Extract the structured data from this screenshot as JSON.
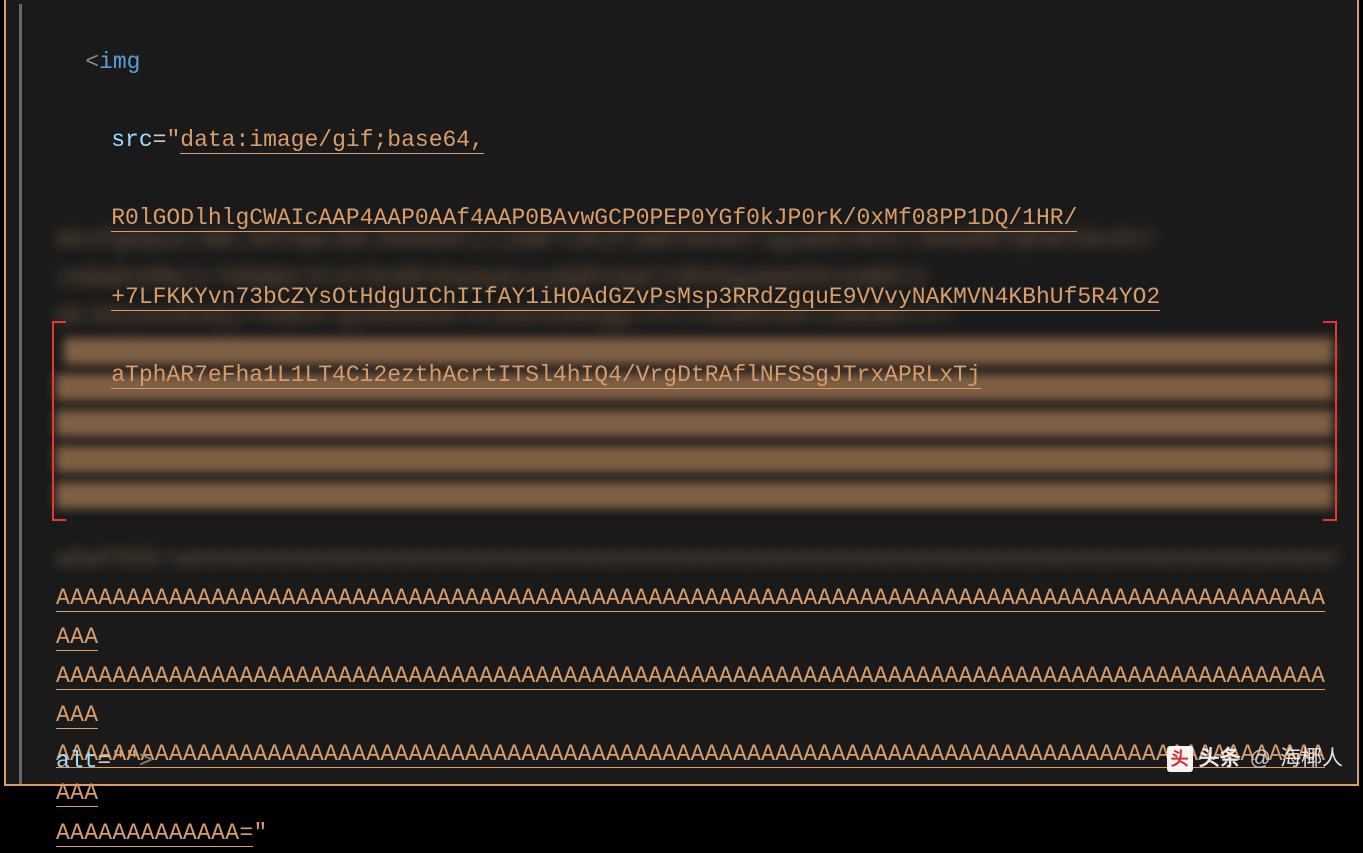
{
  "code": {
    "tag_open_bracket": "<",
    "tag_name": "img",
    "attr_src": "src",
    "eq": "=",
    "quote": "\"",
    "src_value_line1": "data:image/gif;base64,",
    "src_value_line2": "R0lGODlhlgCWAIcAAP4AAP0AAf4AAP0BAvwGCP0PEP0YGf0kJP0rK/0xMf08PP1DQ/1HR/",
    "src_value_line3": "+7LFKKYvn73bCZYsOtHdgUIChIIfAY1iHOAdGZvPsMsp3RRdZgquE9VVvyNAKMVN4KBhUf5R4YO2",
    "src_value_line4": "aTphAR7eFha1L1LT4Ci2ezthAcrtITSl4hIQ4/VrgDtRAflNFSSgJTrxAPRLxTj",
    "a_run1": "AAAAAAAAAAAAAAAAAAAAAAAAAAAAAAAAAAAAAAAAAAAAAAAAAAAAAAAAAAAAAAAAAAAAAAAAAAAAAAAAAAAAAAAAAAAAA",
    "a_run2": "AAAAAAAAAAAAAAAAAAAAAAAAAAAAAAAAAAAAAAAAAAAAAAAAAAAAAAAAAAAAAAAAAAAAAAAAAAAAAAAAAAAAAAAAAAAAA",
    "a_run3": "AAAAAAAAAAAAAAAAAAAAAAAAAAAAAAAAAAAAAAAAAAAAAAAAAAAAAAAAAAAAAAAAAAAAAAAAAAAAAAAAAAAAAAAAAAAAA",
    "a_run4": "AAAAAAAAAAAAA=",
    "attr_alt": "alt",
    "alt_value": "",
    "tag_close_bracket": ">"
  },
  "watermark": {
    "brand": "头条",
    "at": "@",
    "user": "海椰人"
  },
  "blurred": {
    "filler1": "mKxPgKQuarABcJKPnQwlBkJDkRdAFyljUWFTyRjPjWECNkHdYlgywDEcRCk7JRAdMRYQPwFkDcEk7",
    "filler2": "JaBqRnHMwlc7HGWQelFckYDvBFUDwAwAxayQQPhdgFtURkRgwAmGOHvomB9l2",
    "filler3": "mkJHZywnd5AQjrVSBCklguAbHdnKlxcUwCSdAKgglJTLJJudKHJwFuJmbdKxlf/",
    "fillerA": "wDwFRAD/wAAAAAAAAAAAAAAAAAAAAAAAAAAAAAAAAAAAAAAAAAAAAAAAAAAAAAAAAAAAAAAAAAAAAAAAAAAAAAAAAAAAAAAAAAAAAAAAAAAAAAAAAAAAAAAAAAAAAAAAAAAAAAAAAAAAAAAAAAAAA"
  }
}
